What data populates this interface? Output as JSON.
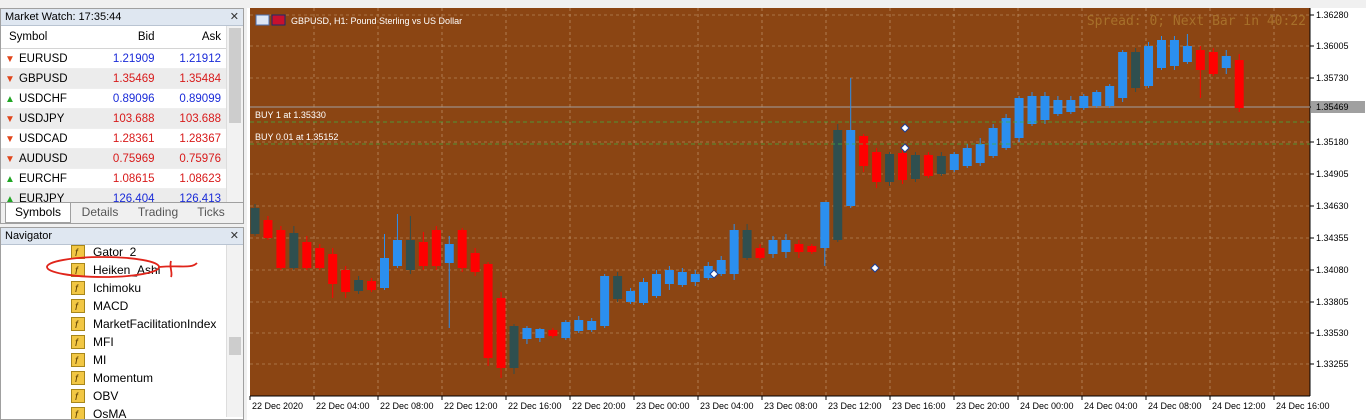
{
  "market_watch": {
    "title": "Market Watch: 17:35:44",
    "headers": {
      "symbol": "Symbol",
      "bid": "Bid",
      "ask": "Ask"
    },
    "rows": [
      {
        "symbol": "EURUSD",
        "bid": "1.21909",
        "ask": "1.21912",
        "dir": "down",
        "color": "#1a2bd8"
      },
      {
        "symbol": "GBPUSD",
        "bid": "1.35469",
        "ask": "1.35484",
        "dir": "down",
        "color": "#d81a1a"
      },
      {
        "symbol": "USDCHF",
        "bid": "0.89096",
        "ask": "0.89099",
        "dir": "up",
        "color": "#1a2bd8"
      },
      {
        "symbol": "USDJPY",
        "bid": "103.688",
        "ask": "103.688",
        "dir": "down",
        "color": "#d81a1a"
      },
      {
        "symbol": "USDCAD",
        "bid": "1.28361",
        "ask": "1.28367",
        "dir": "down",
        "color": "#d81a1a"
      },
      {
        "symbol": "AUDUSD",
        "bid": "0.75969",
        "ask": "0.75976",
        "dir": "down",
        "color": "#d81a1a"
      },
      {
        "symbol": "EURCHF",
        "bid": "1.08615",
        "ask": "1.08623",
        "dir": "up",
        "color": "#d81a1a"
      },
      {
        "symbol": "EURJPY",
        "bid": "126.404",
        "ask": "126.413",
        "dir": "up",
        "color": "#1a2bd8"
      }
    ],
    "tabs": [
      "Symbols",
      "Details",
      "Trading",
      "Ticks"
    ]
  },
  "navigator": {
    "title": "Navigator",
    "items": [
      "Gator_2",
      "Heiken_Ashi",
      "Ichimoku",
      "MACD",
      "MarketFacilitationIndex",
      "MFI",
      "MI",
      "Momentum",
      "OBV",
      "OsMA"
    ]
  },
  "chart": {
    "title": "GBPUSD, H1:  Pound Sterling vs US Dollar",
    "spread_text": "Spread: 0;  Next Bar in 40:22",
    "price_labels": [
      "1.36280",
      "1.36005",
      "1.35730",
      "1.35469",
      "1.35180",
      "1.34905",
      "1.34630",
      "1.34355",
      "1.34080",
      "1.33805",
      "1.33530",
      "1.33255"
    ],
    "current_price": "1.35469",
    "time_labels": [
      "22 Dec 2020",
      "22 Dec 04:00",
      "22 Dec 08:00",
      "22 Dec 12:00",
      "22 Dec 16:00",
      "22 Dec 20:00",
      "23 Dec 00:00",
      "23 Dec 04:00",
      "23 Dec 08:00",
      "23 Dec 12:00",
      "23 Dec 16:00",
      "23 Dec 20:00",
      "24 Dec 00:00",
      "24 Dec 04:00",
      "24 Dec 08:00",
      "24 Dec 12:00",
      "24 Dec 16:00"
    ],
    "orders": [
      {
        "label": "BUY 1 at 1.35330"
      },
      {
        "label": "BUY 0.01 at 1.35152"
      }
    ],
    "colors": {
      "background": "#8b4513",
      "bull": "#2b8fef",
      "bear": "#ff0000",
      "dark": "#2f4f4f",
      "grid": "#c9a27a"
    }
  }
}
